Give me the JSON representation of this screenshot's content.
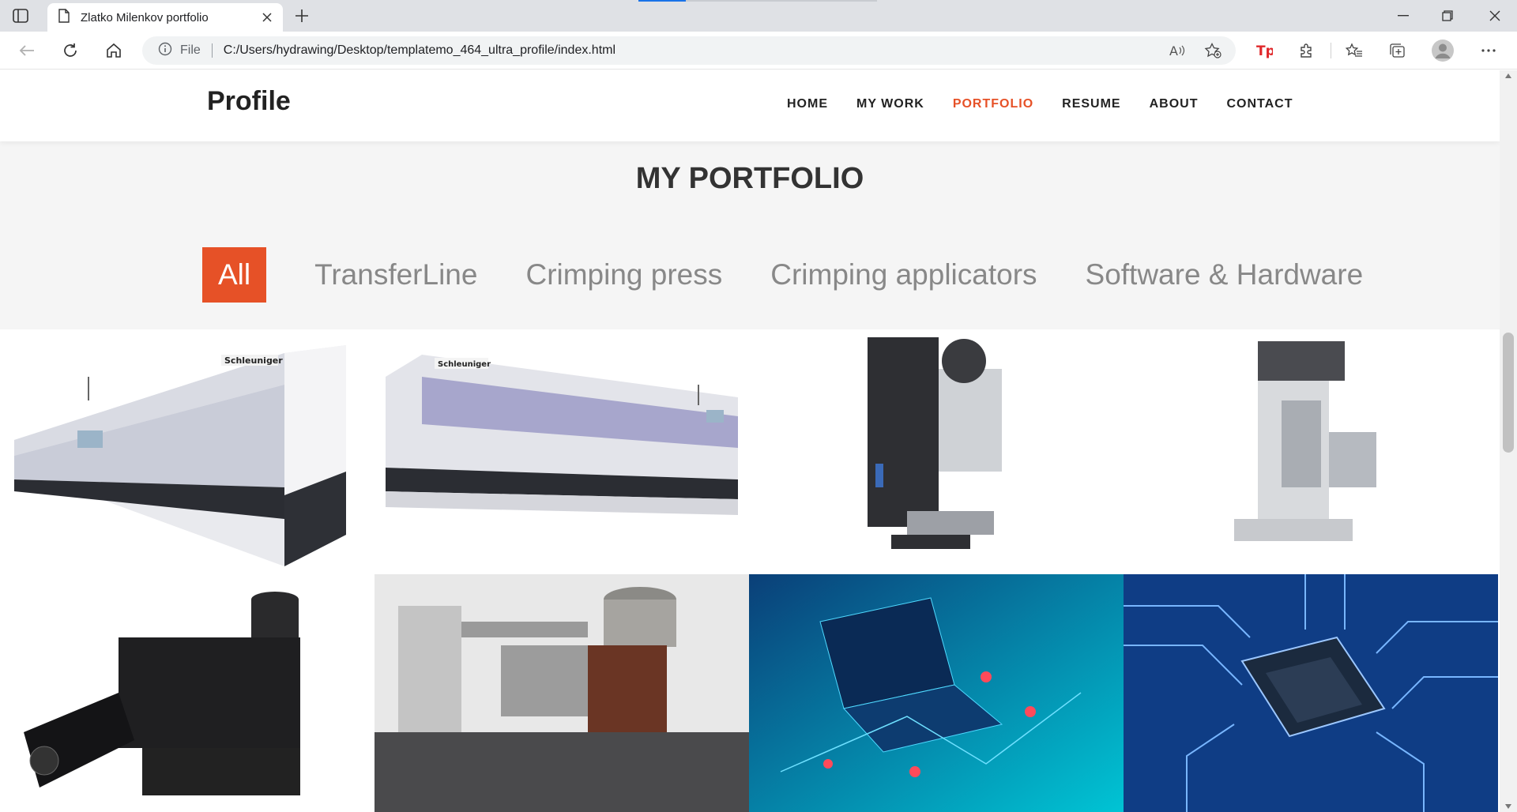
{
  "browser": {
    "tab_title": "Zlatko Milenkov portfolio",
    "address_scheme": "File",
    "url": "C:/Users/hydrawing/Desktop/templatemo_464_ultra_profile/index.html"
  },
  "site": {
    "brand": "Profile",
    "nav": [
      "HOME",
      "MY WORK",
      "PORTFOLIO",
      "RESUME",
      "ABOUT",
      "CONTACT"
    ],
    "nav_active": "PORTFOLIO",
    "section_title_light": "MY",
    "section_title_bold": "PORTFOLIO",
    "filters": [
      "All",
      "TransferLine",
      "Crimping press",
      "Crimping applicators",
      "Software & Hardware"
    ],
    "filter_active": "All",
    "accent_color": "#e65127"
  },
  "portfolio": {
    "items": [
      {
        "name": "transferline-machine-1",
        "icon": "transferline-machine-image"
      },
      {
        "name": "transferline-machine-2",
        "icon": "transferline-machine-image"
      },
      {
        "name": "crimping-press-1",
        "icon": "crimping-press-image"
      },
      {
        "name": "crimping-press-2",
        "icon": "crimping-press-image"
      },
      {
        "name": "crimping-applicator-1",
        "icon": "crimping-applicator-image"
      },
      {
        "name": "crimping-applicator-2",
        "icon": "crimping-applicator-image"
      },
      {
        "name": "software-laptop",
        "icon": "laptop-network-image"
      },
      {
        "name": "hardware-chip",
        "icon": "circuit-chip-image"
      }
    ]
  }
}
